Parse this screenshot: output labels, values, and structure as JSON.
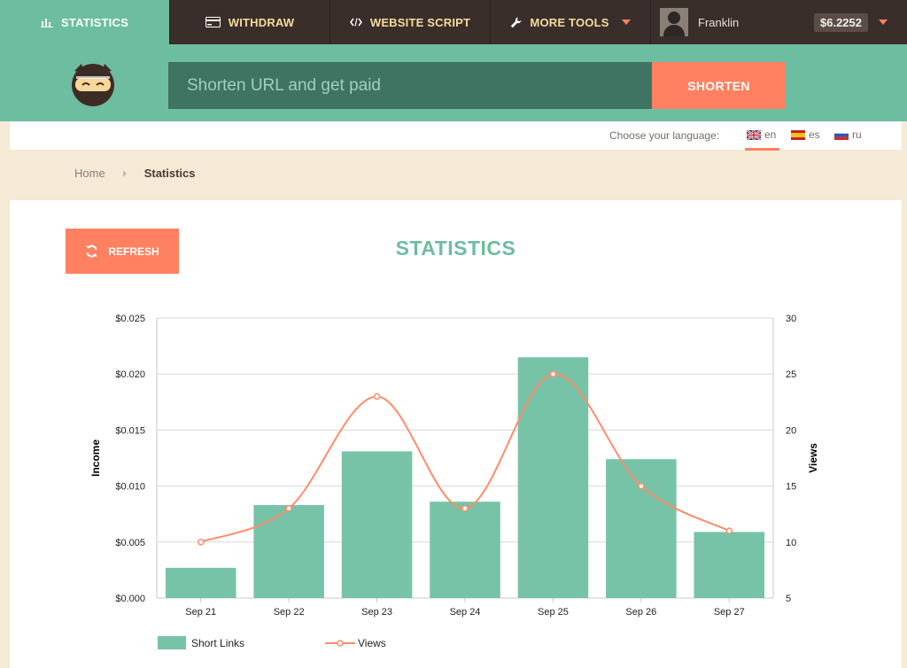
{
  "nav": {
    "items": [
      {
        "label": "STATISTICS",
        "icon": "bar-chart-icon",
        "active": true
      },
      {
        "label": "WITHDRAW",
        "icon": "credit-card-icon",
        "active": false
      },
      {
        "label": "WEBSITE SCRIPT",
        "icon": "code-icon",
        "active": false
      },
      {
        "label": "MORE TOOLS",
        "icon": "wrench-icon",
        "active": false
      }
    ],
    "user": {
      "name": "Franklin",
      "balance": "$6.2252"
    }
  },
  "shortener": {
    "placeholder": "Shorten URL and get paid",
    "button_label": "SHORTEN"
  },
  "language": {
    "label": "Choose your language:",
    "options": [
      {
        "code": "en",
        "active": true
      },
      {
        "code": "es",
        "active": false
      },
      {
        "code": "ru",
        "active": false
      }
    ]
  },
  "breadcrumb": {
    "home": "Home",
    "current": "Statistics"
  },
  "panel": {
    "refresh_label": "REFRESH",
    "title": "STATISTICS"
  },
  "colors": {
    "accent_green": "#6dbda0",
    "accent_orange": "#ff8161",
    "nav_dark": "#3a2e2a",
    "bar_fill": "#77c3a7",
    "line": "#ff8c6b"
  },
  "chart_data": {
    "type": "bar",
    "categories": [
      "Sep 21",
      "Sep 22",
      "Sep 23",
      "Sep 24",
      "Sep 25",
      "Sep 26",
      "Sep 27"
    ],
    "series": [
      {
        "name": "Short Links",
        "type": "bar",
        "axis": "left",
        "values": [
          0.0027,
          0.0083,
          0.0131,
          0.0086,
          0.0215,
          0.0124,
          0.0059
        ]
      },
      {
        "name": "Views",
        "type": "line",
        "axis": "right",
        "values": [
          10,
          13,
          23,
          13,
          25,
          15,
          11
        ]
      }
    ],
    "ylabel": "Income",
    "ylabel_right": "Views",
    "ylim": [
      0,
      0.025
    ],
    "ylim_right": [
      5,
      30
    ],
    "yticks": [
      "$0.000",
      "$0.005",
      "$0.010",
      "$0.015",
      "$0.020",
      "$0.025"
    ],
    "yticks_right": [
      "5",
      "10",
      "15",
      "20",
      "25",
      "30"
    ],
    "grid": true,
    "legend": "bottom-left"
  }
}
